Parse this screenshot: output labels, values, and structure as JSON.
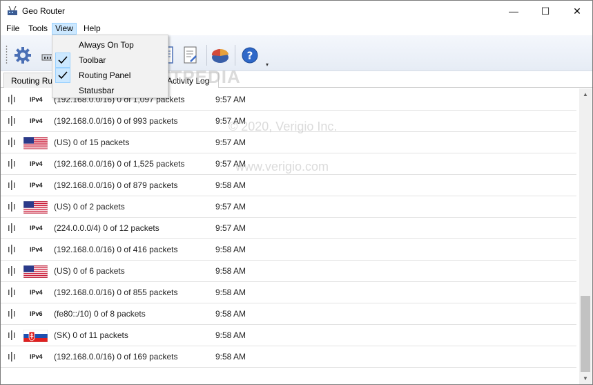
{
  "window": {
    "title": "Geo Router",
    "min": "—",
    "max": "☐",
    "close": "✕"
  },
  "menu": {
    "file": "File",
    "tools": "Tools",
    "view": "View",
    "help": "Help"
  },
  "view_menu": [
    {
      "label": "Always On Top",
      "checked": false
    },
    {
      "label": "Toolbar",
      "checked": true
    },
    {
      "label": "Routing Panel",
      "checked": true
    },
    {
      "label": "Statusbar",
      "checked": false
    }
  ],
  "toolbar": {
    "icons": [
      "settings-gear-icon",
      "network-adapter-icon",
      "document-icon",
      "notes-document-icon",
      "pie-chart-icon",
      "help-icon"
    ],
    "overflow": "▾"
  },
  "tabs": {
    "routing": "Routing Rules",
    "activity": "Activity Log"
  },
  "watermarks": {
    "soft": "SOFTPEDIA",
    "copy": "© 2020, Verigio Inc.",
    "url": "www.verigio.com"
  },
  "rows": [
    {
      "proto": "IPv4",
      "flag": "",
      "info": "(192.168.0.0/16) 0 of 1,097 packets",
      "time": "9:57 AM"
    },
    {
      "proto": "IPv4",
      "flag": "",
      "info": "(192.168.0.0/16) 0 of 993 packets",
      "time": "9:57 AM"
    },
    {
      "proto": "",
      "flag": "us",
      "info": "(US) 0 of 15 packets",
      "time": "9:57 AM"
    },
    {
      "proto": "IPv4",
      "flag": "",
      "info": "(192.168.0.0/16) 0 of 1,525 packets",
      "time": "9:57 AM"
    },
    {
      "proto": "IPv4",
      "flag": "",
      "info": "(192.168.0.0/16) 0 of 879 packets",
      "time": "9:58 AM"
    },
    {
      "proto": "",
      "flag": "us",
      "info": "(US) 0 of 2 packets",
      "time": "9:57 AM"
    },
    {
      "proto": "IPv4",
      "flag": "",
      "info": "(224.0.0.0/4) 0 of 12 packets",
      "time": "9:57 AM"
    },
    {
      "proto": "IPv4",
      "flag": "",
      "info": "(192.168.0.0/16) 0 of 416 packets",
      "time": "9:58 AM"
    },
    {
      "proto": "",
      "flag": "us",
      "info": "(US) 0 of 6 packets",
      "time": "9:58 AM"
    },
    {
      "proto": "IPv4",
      "flag": "",
      "info": "(192.168.0.0/16) 0 of 855 packets",
      "time": "9:58 AM"
    },
    {
      "proto": "IPv6",
      "flag": "",
      "info": "(fe80::/10) 0 of 8 packets",
      "time": "9:58 AM"
    },
    {
      "proto": "",
      "flag": "sk",
      "info": "(SK) 0 of 11 packets",
      "time": "9:58 AM"
    },
    {
      "proto": "IPv4",
      "flag": "",
      "info": "(192.168.0.0/16) 0 of 169 packets",
      "time": "9:58 AM"
    }
  ]
}
